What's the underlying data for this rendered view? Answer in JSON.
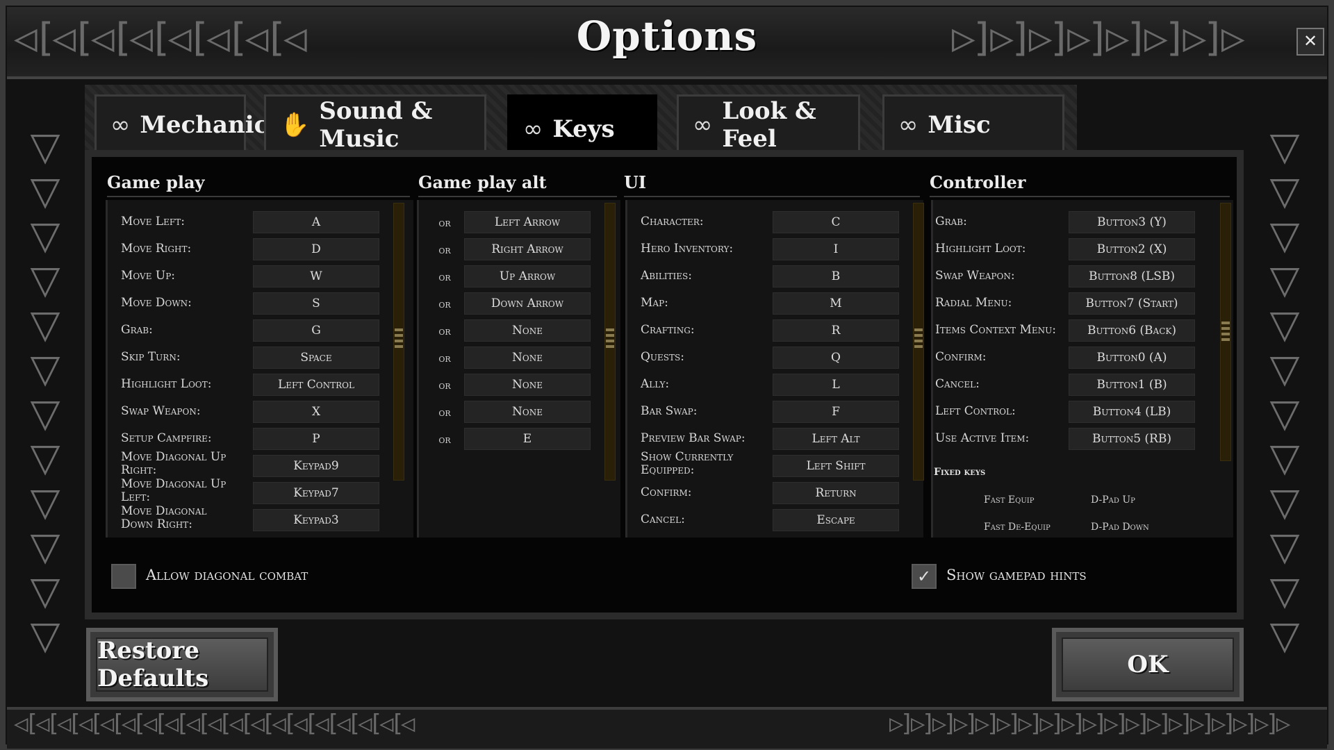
{
  "window": {
    "title": "Options",
    "close_glyph": "✕"
  },
  "ornaments": {
    "top_left": "◁[◁[◁[◁[◁[◁[◁[◁",
    "top_right": "▷]▷]▷]▷]▷]▷]▷]▷",
    "side_glyph": "▽",
    "bottom_left": "◁[◁[◁[◁[◁[◁[◁[◁[◁[◁[◁[◁[◁[◁[◁[◁[◁[◁[◁",
    "bottom_right": "▷]▷]▷]▷]▷]▷]▷]▷]▷]▷]▷]▷]▷]▷]▷]▷]▷]▷]▷"
  },
  "tabs": [
    {
      "label": "Mechanics",
      "icon": "∞",
      "icon_name": "infinity-icon"
    },
    {
      "label": "Sound & Music",
      "icon": "✋",
      "icon_name": "hand-icon"
    },
    {
      "label": "Keys",
      "icon": "∞",
      "icon_name": "infinity-icon",
      "active": true
    },
    {
      "label": "Look & Feel",
      "icon": "∞",
      "icon_name": "infinity-icon"
    },
    {
      "label": "Misc",
      "icon": "∞",
      "icon_name": "infinity-icon"
    }
  ],
  "sections": {
    "gameplay": {
      "title": "Game play",
      "rows": [
        {
          "label": "Move Left:",
          "key": "A"
        },
        {
          "label": "Move Right:",
          "key": "D"
        },
        {
          "label": "Move Up:",
          "key": "W"
        },
        {
          "label": "Move Down:",
          "key": "S"
        },
        {
          "label": "Grab:",
          "key": "G"
        },
        {
          "label": "Skip Turn:",
          "key": "Space"
        },
        {
          "label": "Highlight Loot:",
          "key": "Left Control"
        },
        {
          "label": "Swap Weapon:",
          "key": "X"
        },
        {
          "label": "Setup Campfire:",
          "key": "P"
        },
        {
          "label": "Move Diagonal Up Right:",
          "key": "Keypad9"
        },
        {
          "label": "Move Diagonal Up Left:",
          "key": "Keypad7"
        },
        {
          "label": "Move Diagonal Down Right:",
          "key": "Keypad3"
        },
        {
          "label": "Move Diagonal Down",
          "key": ""
        }
      ]
    },
    "gameplay_alt": {
      "title": "Game play alt",
      "or_label": "or",
      "keys": [
        "Left Arrow",
        "Right Arrow",
        "Up Arrow",
        "Down Arrow",
        "None",
        "None",
        "None",
        "None",
        "E"
      ]
    },
    "ui": {
      "title": "UI",
      "rows": [
        {
          "label": "Character:",
          "key": "C"
        },
        {
          "label": "Hero Inventory:",
          "key": "I"
        },
        {
          "label": "Abilities:",
          "key": "B"
        },
        {
          "label": "Map:",
          "key": "M"
        },
        {
          "label": "Crafting:",
          "key": "R"
        },
        {
          "label": "Quests:",
          "key": "Q"
        },
        {
          "label": "Ally:",
          "key": "L"
        },
        {
          "label": "Bar Swap:",
          "key": "F"
        },
        {
          "label": "Preview Bar Swap:",
          "key": "Left Alt"
        },
        {
          "label": "Show Currently Equipped:",
          "key": "Left Shift"
        },
        {
          "label": "Confirm:",
          "key": "Return"
        },
        {
          "label": "Cancel:",
          "key": "Escape"
        }
      ]
    },
    "controller": {
      "title": "Controller",
      "rows": [
        {
          "label": "Grab:",
          "key": "Button3 (Y)"
        },
        {
          "label": "Highlight Loot:",
          "key": "Button2 (X)"
        },
        {
          "label": "Swap Weapon:",
          "key": "Button8 (LSB)"
        },
        {
          "label": "Radial Menu:",
          "key": "Button7 (Start)"
        },
        {
          "label": "Items Context Menu:",
          "key": "Button6 (Back)"
        },
        {
          "label": "Confirm:",
          "key": "Button0 (A)"
        },
        {
          "label": "Cancel:",
          "key": "Button1 (B)"
        },
        {
          "label": "Left Control:",
          "key": "Button4 (LB)"
        },
        {
          "label": "Use Active Item:",
          "key": "Button5 (RB)"
        }
      ],
      "fixed_title": "Fixed keys",
      "fixed": [
        {
          "action": "Fast Equip",
          "key": "D-Pad Up"
        },
        {
          "action": "Fast De-Equip",
          "key": "D-Pad Down"
        }
      ]
    }
  },
  "options": {
    "allow_diagonal_combat": {
      "label": "Allow diagonal combat",
      "checked": false,
      "mark": ""
    },
    "show_gamepad_hints": {
      "label": "Show gamepad hints",
      "checked": true,
      "mark": "✓"
    }
  },
  "buttons": {
    "restore": "Restore Defaults",
    "ok": "OK"
  }
}
